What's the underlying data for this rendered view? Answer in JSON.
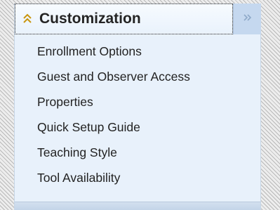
{
  "panel": {
    "title": "Customization",
    "collapse_icon": "double-chevron-up-icon",
    "expand_icon": "double-chevron-right-icon",
    "items": [
      {
        "label": "Enrollment Options"
      },
      {
        "label": "Guest and Observer Access"
      },
      {
        "label": "Properties"
      },
      {
        "label": "Quick Setup Guide"
      },
      {
        "label": "Teaching Style"
      },
      {
        "label": "Tool Availability"
      }
    ]
  },
  "colors": {
    "panel_background": "#e8f1fb",
    "tab_background": "#c5d8ef",
    "chevron_accent": "#d4a017"
  }
}
